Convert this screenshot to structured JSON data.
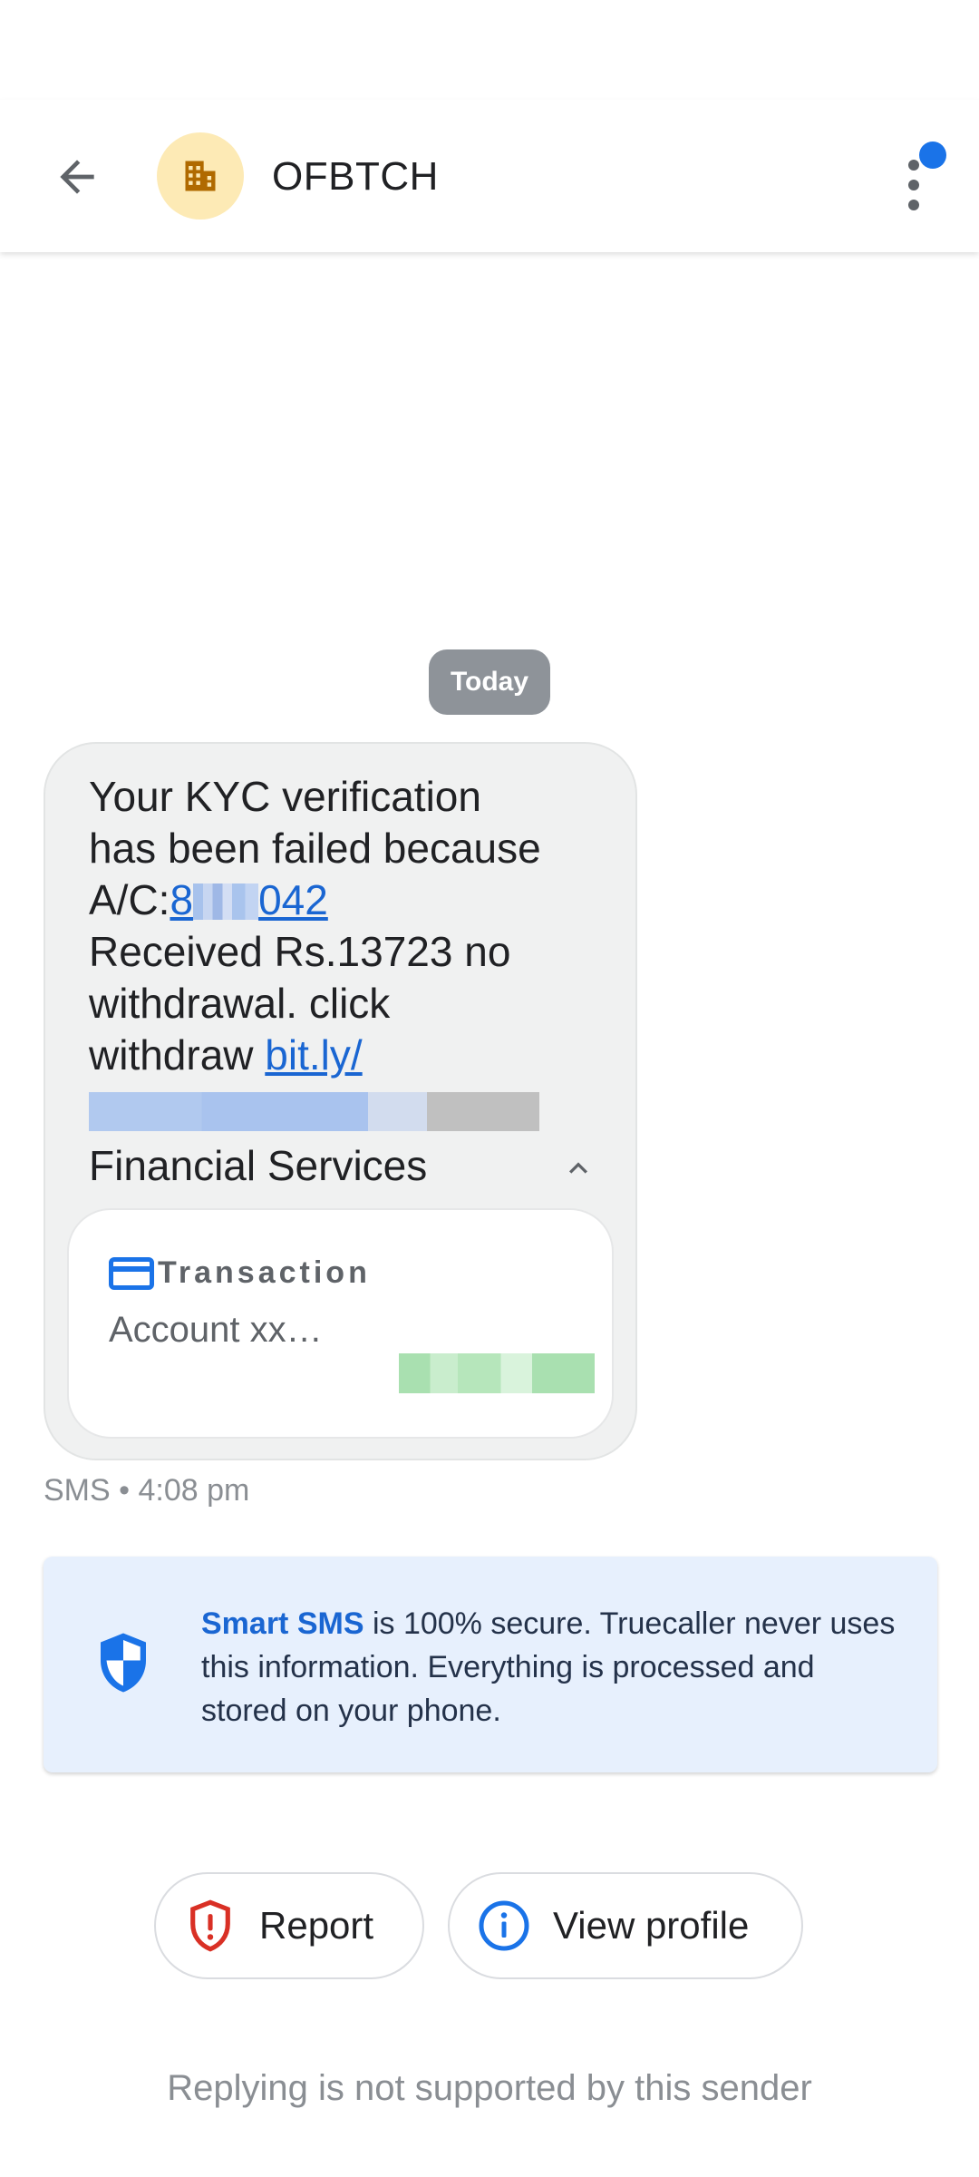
{
  "header": {
    "sender": "OFBTCH",
    "back_icon": "arrow-left-icon",
    "avatar_icon": "building-icon",
    "menu_icon": "more-vert-icon"
  },
  "conversation": {
    "date_chip": "Today",
    "message": {
      "line1": "Your KYC verification",
      "line2": "has been failed because",
      "line3_prefix": "A/C:",
      "account_link_start": "8",
      "account_link_end": "042",
      "line4": "Received Rs.13723 no",
      "line5": "withdrawal. click",
      "line6_prefix": "withdraw ",
      "url_text": "bit.ly/"
    },
    "category_label": "Financial Services",
    "transaction_card": {
      "title": "Transaction",
      "description": "Account xx…"
    },
    "meta": "SMS • 4:08 pm"
  },
  "info_card": {
    "strong": "Smart SMS",
    "text": " is 100% secure. Truecaller never uses this information. Everything is processed and stored on your phone."
  },
  "actions": {
    "report_label": "Report",
    "view_profile_label": "View profile"
  },
  "footer_note": "Replying is not supported by this sender",
  "colors": {
    "accent": "#1a73e8",
    "link": "#1a66d2",
    "report_red": "#d93025",
    "bubble_bg": "#f0f1f1",
    "info_bg": "#e7f0fd",
    "avatar_bg": "#fdeab5",
    "avatar_icon": "#b06a00"
  }
}
